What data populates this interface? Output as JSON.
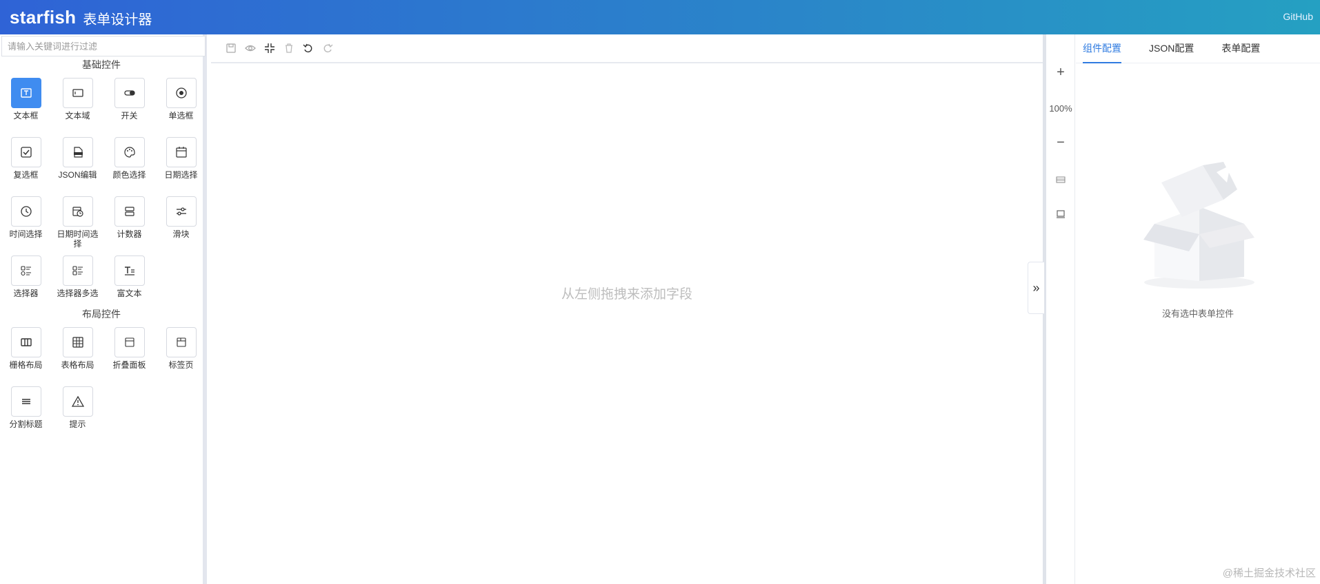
{
  "header": {
    "brand": "starfish",
    "subtitle": "表单设计器",
    "github_label": "GitHub"
  },
  "left": {
    "filter_placeholder": "请输入关键词进行过滤",
    "groups": [
      {
        "title": "基础控件",
        "items": [
          {
            "label": "文本框",
            "icon": "text-input-icon",
            "active": true
          },
          {
            "label": "文本域",
            "icon": "textarea-icon"
          },
          {
            "label": "开关",
            "icon": "switch-icon"
          },
          {
            "label": "单选框",
            "icon": "radio-icon"
          },
          {
            "label": "复选框",
            "icon": "checkbox-icon"
          },
          {
            "label": "JSON编辑",
            "icon": "json-file-icon"
          },
          {
            "label": "颜色选择",
            "icon": "palette-icon"
          },
          {
            "label": "日期选择",
            "icon": "calendar-icon"
          },
          {
            "label": "时间选择",
            "icon": "clock-icon"
          },
          {
            "label": "日期时间选择",
            "icon": "calendar-clock-icon"
          },
          {
            "label": "计数器",
            "icon": "counter-icon"
          },
          {
            "label": "滑块",
            "icon": "slider-icon"
          },
          {
            "label": "选择器",
            "icon": "select-icon"
          },
          {
            "label": "选择器多选",
            "icon": "multi-select-icon"
          },
          {
            "label": "富文本",
            "icon": "rich-text-icon"
          }
        ]
      },
      {
        "title": "布局控件",
        "items": [
          {
            "label": "栅格布局",
            "icon": "grid-layout-icon"
          },
          {
            "label": "表格布局",
            "icon": "table-layout-icon"
          },
          {
            "label": "折叠面板",
            "icon": "collapse-panel-icon"
          },
          {
            "label": "标签页",
            "icon": "tabs-icon"
          },
          {
            "label": "分割标题",
            "icon": "divider-title-icon"
          },
          {
            "label": "提示",
            "icon": "alert-icon"
          }
        ]
      }
    ]
  },
  "toolbar": {
    "buttons": [
      "save-icon",
      "preview-icon",
      "fullscreen-exit-icon",
      "delete-icon",
      "undo-icon",
      "redo-icon"
    ]
  },
  "canvas": {
    "empty_hint": "从左侧拖拽来添加字段",
    "collapse_glyph": "»"
  },
  "zoom": {
    "plus": "+",
    "level": "100%",
    "minus": "−"
  },
  "right": {
    "tabs": [
      "组件配置",
      "JSON配置",
      "表单配置"
    ],
    "active_tab": 0,
    "empty_text": "没有选中表单控件"
  },
  "watermark": "@稀土掘金技术社区",
  "colors": {
    "accent": "#2f7be0",
    "header_start": "#2f63d6",
    "header_end": "#25a0c2",
    "active_control": "#3f8cf0"
  }
}
